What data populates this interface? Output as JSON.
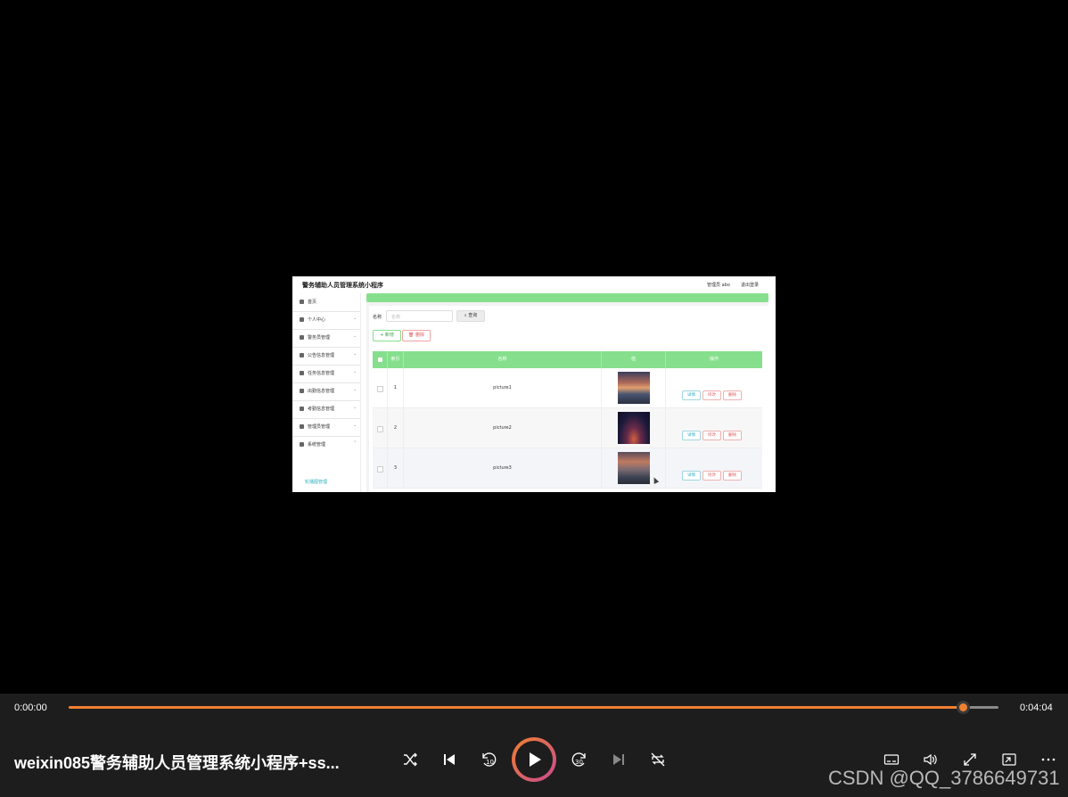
{
  "app": {
    "title": "警务辅助人员管理系统小程序",
    "header_user": "管理员 abo",
    "header_logout": "退出登录"
  },
  "sidebar": {
    "items": [
      {
        "label": "首页",
        "has_chevron": false
      },
      {
        "label": "个人中心",
        "has_chevron": true
      },
      {
        "label": "警务员管理",
        "has_chevron": true
      },
      {
        "label": "公告信息管理",
        "has_chevron": true
      },
      {
        "label": "任务信息管理",
        "has_chevron": true
      },
      {
        "label": "出勤信息管理",
        "has_chevron": true
      },
      {
        "label": "考勤信息管理",
        "has_chevron": true
      },
      {
        "label": "管理员管理",
        "has_chevron": true
      },
      {
        "label": "系统管理",
        "has_chevron": true
      }
    ],
    "sub_item": "轮播图管理"
  },
  "search": {
    "label": "名称",
    "placeholder": "名称",
    "query_label": "查询"
  },
  "toolbar": {
    "add_label": "+ 新增",
    "delete_label": "删除"
  },
  "table": {
    "headers": [
      "索引",
      "名称",
      "值",
      "操作"
    ],
    "rows": [
      {
        "index": "1",
        "name": "picture1"
      },
      {
        "index": "2",
        "name": "picture2"
      },
      {
        "index": "3",
        "name": "picture3"
      }
    ],
    "actions": {
      "detail": "详情",
      "edit": "修改",
      "remove": "删除"
    }
  },
  "player": {
    "current_time": "0:00:00",
    "total_time": "0:04:04",
    "progress": 0.964,
    "title": "weixin085警务辅助人员管理系统小程序+ss...",
    "accent": "#f08030",
    "icons": [
      "shuffle-icon",
      "previous-icon",
      "rewind-10-icon",
      "play-icon",
      "forward-30-icon",
      "next-icon",
      "repeat-off-icon",
      "subtitles-icon",
      "volume-icon",
      "fullscreen-icon",
      "mini-player-icon",
      "more-icon"
    ]
  },
  "watermark": "CSDN @QQ_3786649731"
}
